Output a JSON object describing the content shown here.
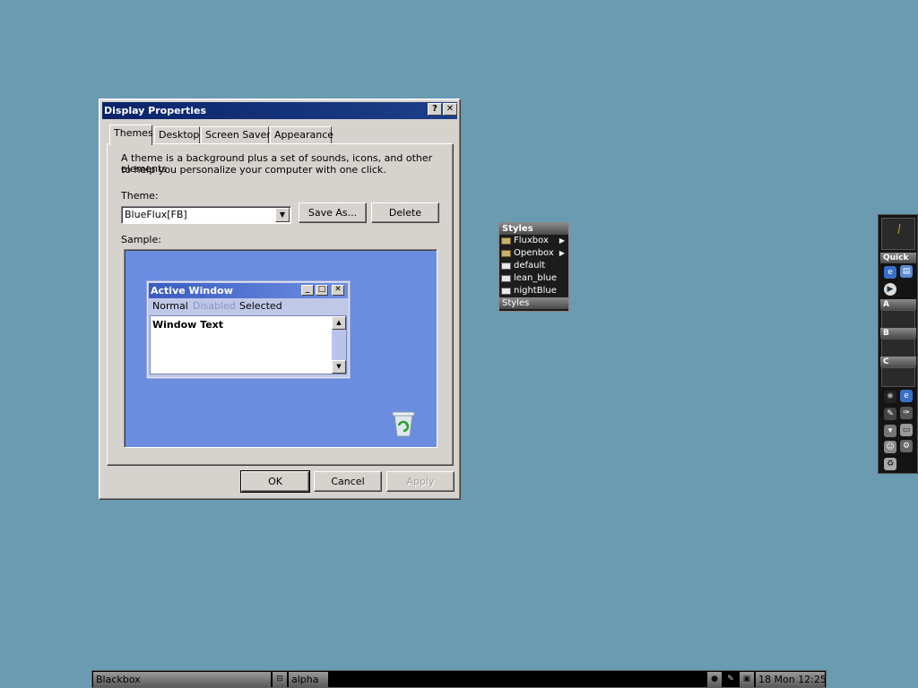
{
  "dialog": {
    "title": "Display Properties",
    "help_label": "?",
    "close_label": "✕",
    "tabs": [
      {
        "label": "Themes",
        "active": true
      },
      {
        "label": "Desktop",
        "active": false
      },
      {
        "label": "Screen Saver",
        "active": false
      },
      {
        "label": "Appearance",
        "active": false
      }
    ],
    "description_line1": "A theme is a background plus a set of sounds, icons, and other elements",
    "description_line2": "to help you personalize your computer with one click.",
    "theme_label": "Theme:",
    "theme_value": "BlueFlux[FB]",
    "save_as_label": "Save As...",
    "delete_label": "Delete",
    "sample_label": "Sample:",
    "sample": {
      "window_title": "Active Window",
      "menu_normal": "Normal",
      "menu_disabled": "Disabled",
      "menu_selected": "Selected",
      "window_text": "Window Text"
    },
    "ok_label": "OK",
    "cancel_label": "Cancel",
    "apply_label": "Apply"
  },
  "styles_menu": {
    "title": "Styles",
    "items": [
      {
        "label": "Fluxbox",
        "icon": "folder-icon",
        "submenu": true
      },
      {
        "label": "Openbox",
        "icon": "folder-icon",
        "submenu": true
      },
      {
        "label": "default",
        "icon": "style-file-icon",
        "submenu": false
      },
      {
        "label": "lean_blue",
        "icon": "style-file-icon",
        "submenu": false
      },
      {
        "label": "nightBlue",
        "icon": "style-file-icon",
        "submenu": false
      }
    ],
    "footer": "Styles"
  },
  "slit": {
    "quick_label": "Quick",
    "a_label": "A",
    "b_label": "B",
    "c_label": "C"
  },
  "taskbar": {
    "workspace": "Blackbox",
    "window": "alpha",
    "clock": "18 Mon 12:25"
  },
  "colors": {
    "desktop": "#6a9bb1",
    "title_bar": "#0a246a",
    "sample_bg": "#6a8de0",
    "dialog_face": "#d6d3ce"
  }
}
